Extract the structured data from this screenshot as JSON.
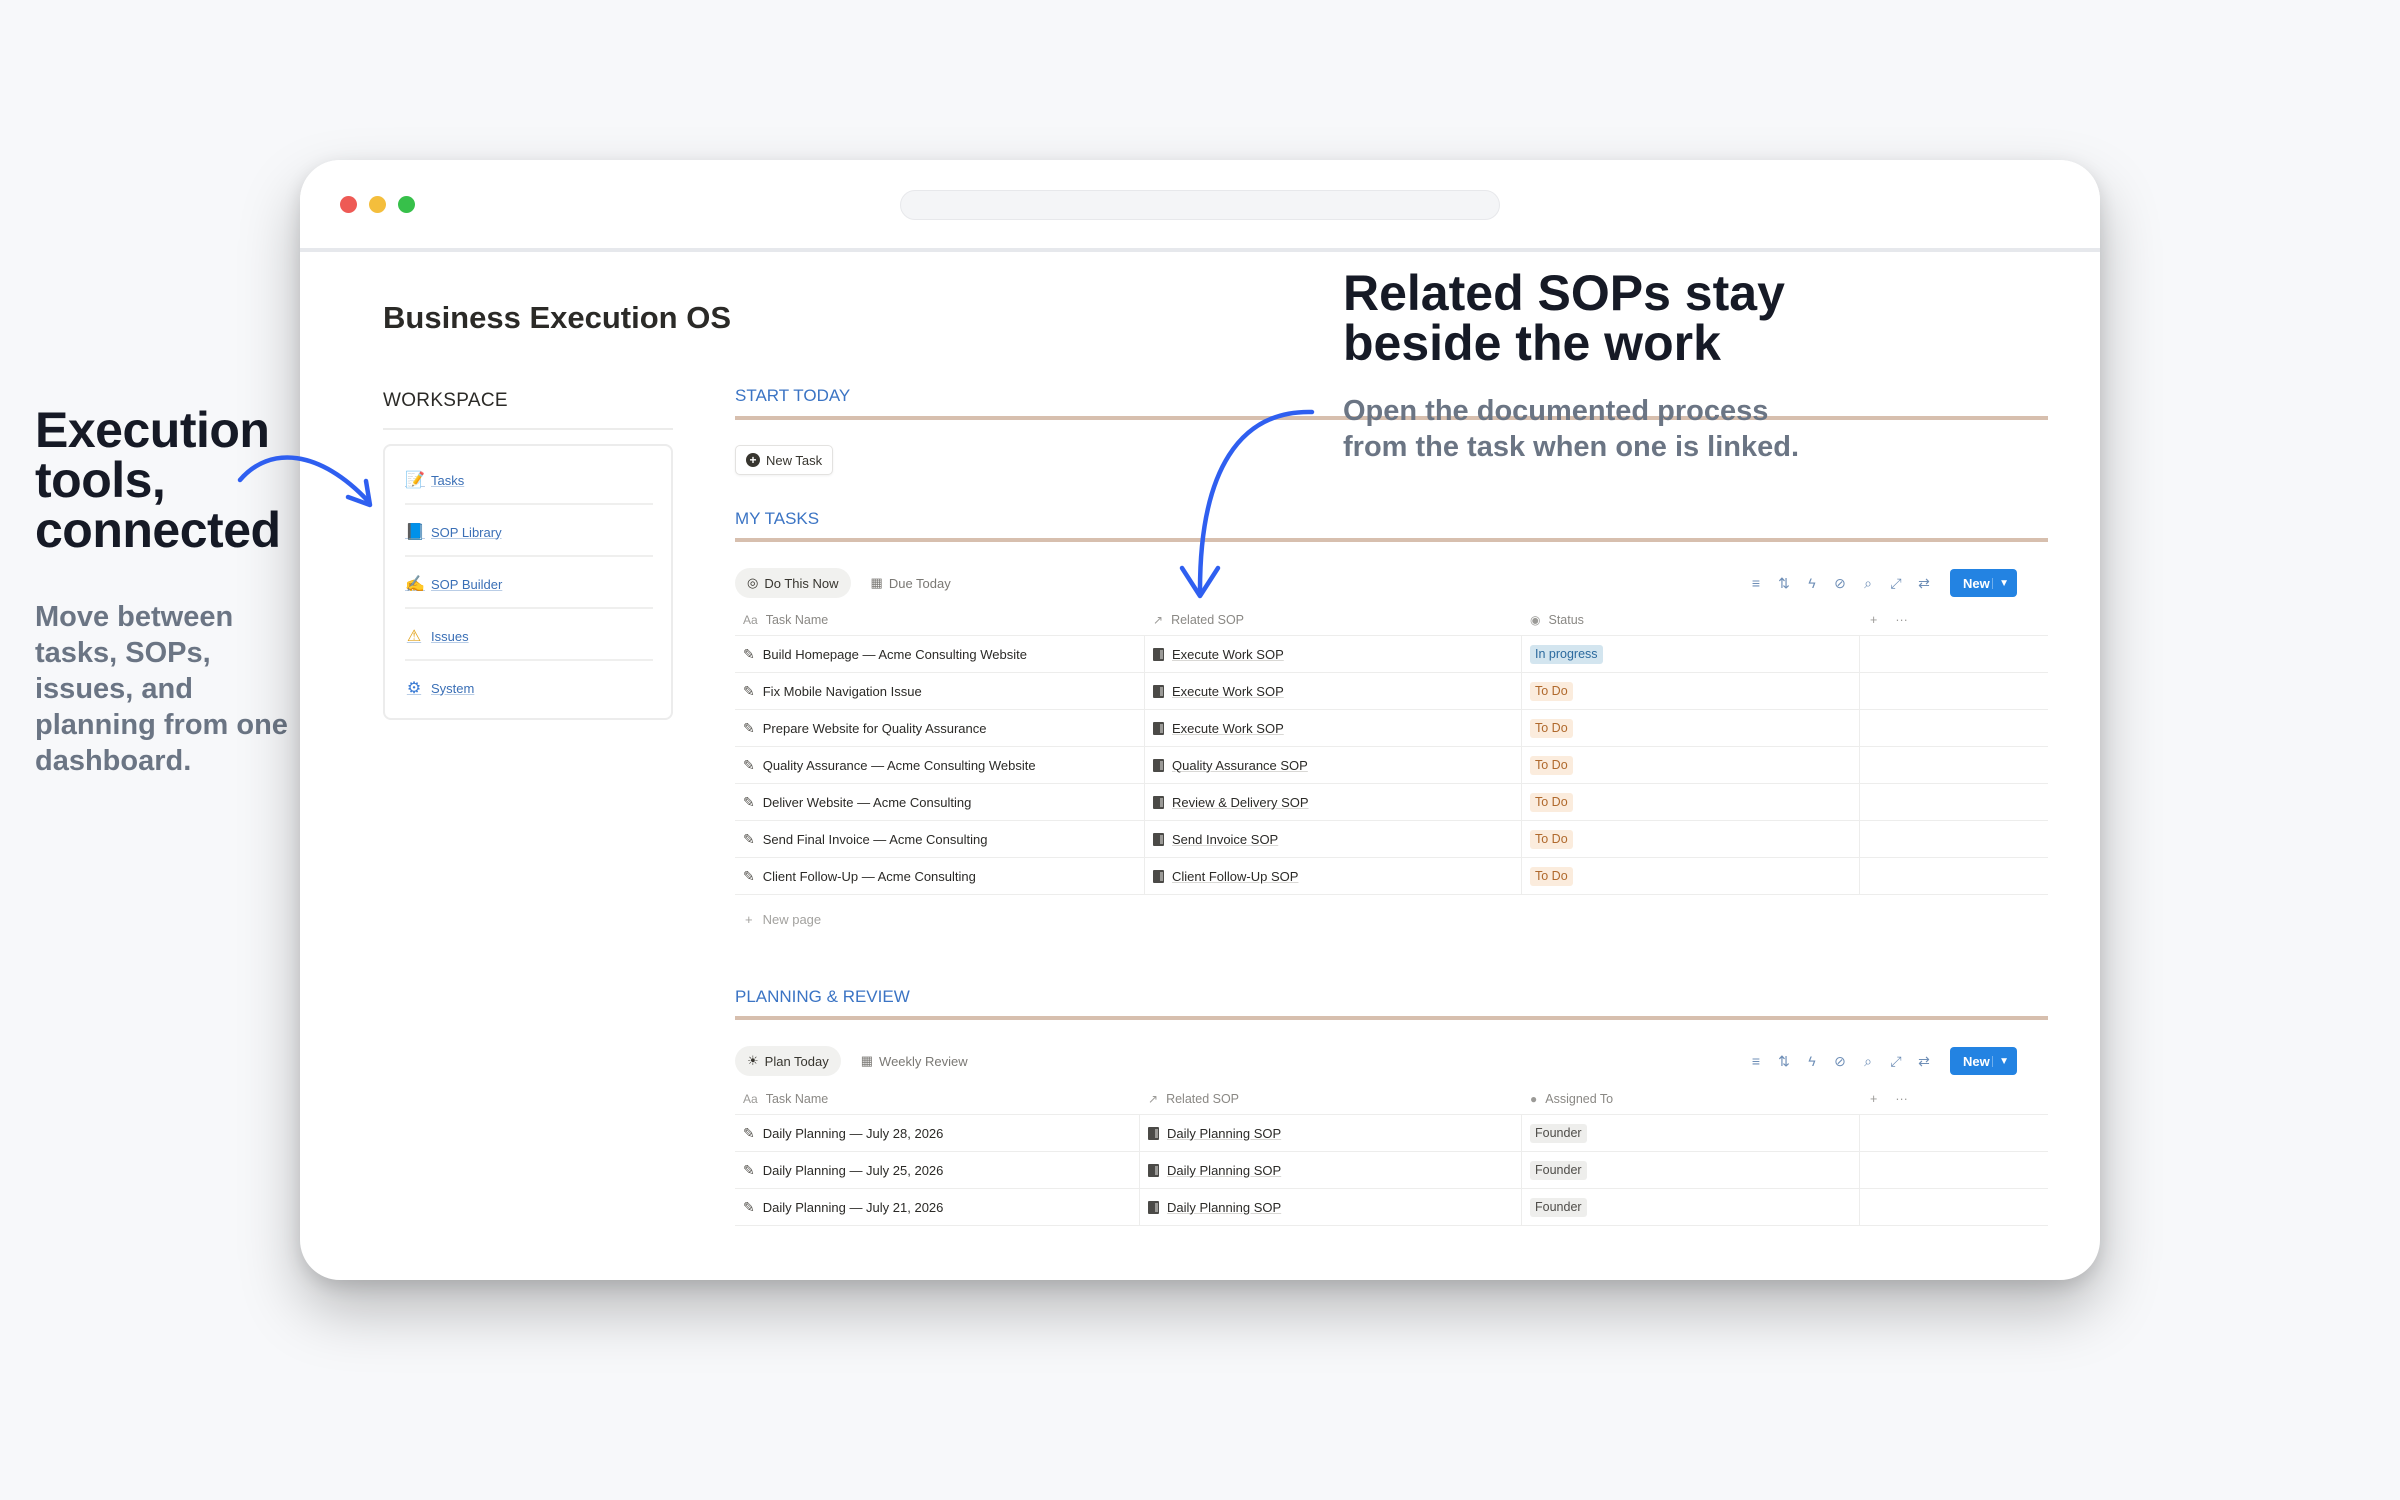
{
  "left_callout": {
    "title_lines": [
      "Execution",
      "tools,",
      "connected"
    ],
    "subtitle": "Move between tasks, SOPs, issues, and planning from one dashboard."
  },
  "right_callout": {
    "title_lines": [
      "Related SOPs stay",
      "beside the work"
    ],
    "subtitle_lines": [
      "Open the documented process",
      "from the task when one is linked."
    ]
  },
  "accent_color": "#2f5ff0",
  "page": {
    "title": "Business Execution OS",
    "workspace_label": "WORKSPACE",
    "workspace_items": [
      {
        "icon": "memo-icon",
        "glyph": "📝",
        "label": "Tasks"
      },
      {
        "icon": "book-icon",
        "glyph": "📘",
        "label": "SOP Library"
      },
      {
        "icon": "writing-hand-icon",
        "glyph": "✍",
        "label": "SOP Builder"
      },
      {
        "icon": "warning-icon",
        "glyph": "⚠",
        "label": "Issues"
      },
      {
        "icon": "gear-icon",
        "glyph": "⚙",
        "label": "System"
      }
    ]
  },
  "start_today": {
    "heading": "START TODAY",
    "new_task_label": "New Task"
  },
  "my_tasks": {
    "heading": "MY TASKS",
    "tabs": [
      "Do This Now",
      "Due Today"
    ],
    "new_label": "New",
    "columns": [
      "Task Name",
      "Related SOP",
      "Status"
    ],
    "rows": [
      {
        "task": "Build Homepage — Acme Consulting Website",
        "sop": "Execute Work SOP",
        "status": "In progress"
      },
      {
        "task": "Fix Mobile Navigation Issue",
        "sop": "Execute Work SOP",
        "status": "To Do"
      },
      {
        "task": "Prepare Website for Quality Assurance",
        "sop": "Execute Work SOP",
        "status": "To Do"
      },
      {
        "task": "Quality Assurance — Acme Consulting Website",
        "sop": "Quality Assurance SOP",
        "status": "To Do"
      },
      {
        "task": "Deliver Website — Acme Consulting",
        "sop": "Review & Delivery SOP",
        "status": "To Do"
      },
      {
        "task": "Send Final Invoice — Acme Consulting",
        "sop": "Send Invoice SOP",
        "status": "To Do"
      },
      {
        "task": "Client Follow-Up — Acme Consulting",
        "sop": "Client Follow-Up SOP",
        "status": "To Do"
      }
    ],
    "new_page_label": "New page"
  },
  "planning": {
    "heading": "PLANNING & REVIEW",
    "tabs": [
      "Plan Today",
      "Weekly Review"
    ],
    "new_label": "New",
    "columns": [
      "Task Name",
      "Related SOP",
      "Assigned To"
    ],
    "rows": [
      {
        "task": "Daily Planning — July 28, 2026",
        "sop": "Daily Planning SOP",
        "assignee": "Founder"
      },
      {
        "task": "Daily Planning — July 25, 2026",
        "sop": "Daily Planning SOP",
        "assignee": "Founder"
      },
      {
        "task": "Daily Planning — July 21, 2026",
        "sop": "Daily Planning SOP",
        "assignee": "Founder"
      }
    ]
  }
}
